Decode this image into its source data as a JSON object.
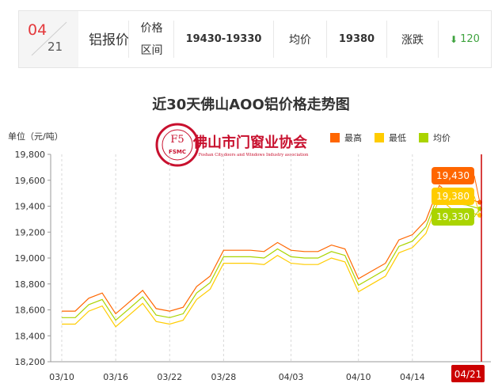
{
  "price_bar": {
    "month": "04",
    "day": "21",
    "product": "铝报价",
    "range_label_line1": "价格",
    "range_label_line2": "区间",
    "range_value": "19430-19330",
    "avg_label": "均价",
    "avg_value": "19380",
    "change_label": "涨跌",
    "change_value": "120",
    "change_color": "#3fa33f"
  },
  "logo": {
    "text_cn": "佛山市门窗业协会",
    "text_en": "Foshan City,doors and Windows Industry association",
    "mark_letters": "FSMC",
    "ring_text": "佛山市门窗业协会"
  },
  "chart_data": {
    "type": "line",
    "title": "近30天佛山AOO铝价格走势图",
    "ylabel": "单位（元/吨）",
    "ylim": [
      18200,
      19800
    ],
    "yticks": [
      "19,800",
      "19,600",
      "19,400",
      "19,200",
      "19,000",
      "18,800",
      "18,600",
      "18,400",
      "18,200"
    ],
    "xtick_labels": [
      "03/10",
      "03/16",
      "03/22",
      "03/28",
      "04/03",
      "04/10",
      "04/14"
    ],
    "grid": "vertical dashed",
    "legend_position": "top-right",
    "x": [
      "03/10",
      "03/11",
      "03/14",
      "03/15",
      "03/16",
      "03/17",
      "03/18",
      "03/21",
      "03/22",
      "03/23",
      "03/24",
      "03/25",
      "03/28",
      "03/29",
      "03/30",
      "03/31",
      "04/01",
      "04/03",
      "04/04",
      "04/06",
      "04/07",
      "04/08",
      "04/10",
      "04/11",
      "04/12",
      "04/13",
      "04/14",
      "04/15",
      "04/18",
      "04/19",
      "04/20",
      "04/21"
    ],
    "series": [
      {
        "name": "最高",
        "color": "#ff6600",
        "values": [
          18590,
          18590,
          18690,
          18730,
          18570,
          18660,
          18750,
          18610,
          18590,
          18620,
          18780,
          18860,
          19060,
          19060,
          19060,
          19050,
          19120,
          19060,
          19050,
          19050,
          19100,
          19070,
          18840,
          18900,
          18960,
          19140,
          19180,
          19290,
          19560,
          19470,
          19460,
          19430
        ]
      },
      {
        "name": "最低",
        "color": "#ffcc00",
        "values": [
          18490,
          18490,
          18590,
          18630,
          18470,
          18560,
          18650,
          18510,
          18490,
          18520,
          18680,
          18760,
          18960,
          18960,
          18960,
          18950,
          19020,
          18960,
          18950,
          18950,
          19000,
          18970,
          18740,
          18800,
          18860,
          19040,
          19080,
          19190,
          19460,
          19370,
          19360,
          19330
        ]
      },
      {
        "name": "均价",
        "color": "#aad400",
        "values": [
          18540,
          18540,
          18640,
          18680,
          18520,
          18610,
          18700,
          18560,
          18540,
          18570,
          18730,
          18810,
          19010,
          19010,
          19010,
          19000,
          19070,
          19010,
          19000,
          19000,
          19050,
          19020,
          18790,
          18850,
          18910,
          19090,
          19130,
          19240,
          19510,
          19420,
          19410,
          19380
        ]
      }
    ],
    "end_labels": [
      "19,430",
      "19,380",
      "19,330"
    ],
    "current_date_label": "04/21",
    "marker_color": "#cc0000"
  }
}
